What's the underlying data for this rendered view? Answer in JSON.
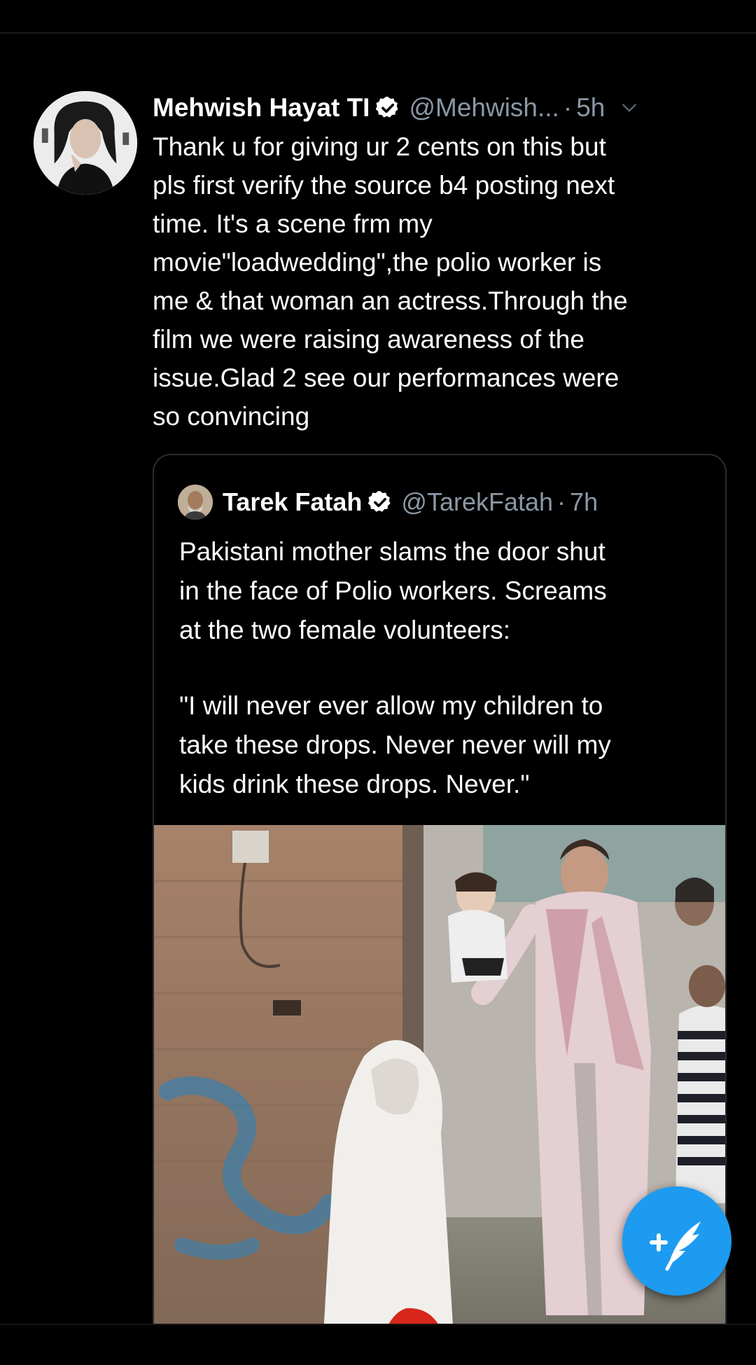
{
  "tweet": {
    "display_name": "Mehwish Hayat TI",
    "handle": "@Mehwish...",
    "separator": "·",
    "time": "5h",
    "text": "Thank u for giving ur 2 cents on this but\npls first verify the source b4 posting next\ntime. It's a scene frm my\nmovie\"loadwedding\",the polio worker is\nme & that woman an actress.Through the\nfilm we were raising awareness of the\nissue.Glad 2 see our performances were\nso convincing",
    "avatar_icon": "profile-photo",
    "verified_icon": "verified-badge-icon",
    "menu_icon": "chevron-down-icon"
  },
  "quoted_tweet": {
    "display_name": "Tarek Fatah",
    "handle": "@TarekFatah",
    "separator": "·",
    "time": "7h",
    "paragraph_1": "Pakistani mother slams the door shut\nin the face of Polio workers. Screams\nat the two female volunteers:",
    "paragraph_2": "\"I will never ever allow my children to\ntake these drops. Never never will my\nkids drink these drops. Never.\"",
    "media_icon": "video-thumbnail"
  },
  "fab": {
    "icon": "compose-tweet-icon",
    "glyph": "+"
  },
  "colors": {
    "background": "#000000",
    "text": "#ffffff",
    "secondary": "#8b98a5",
    "accent": "#1d9bf0"
  }
}
